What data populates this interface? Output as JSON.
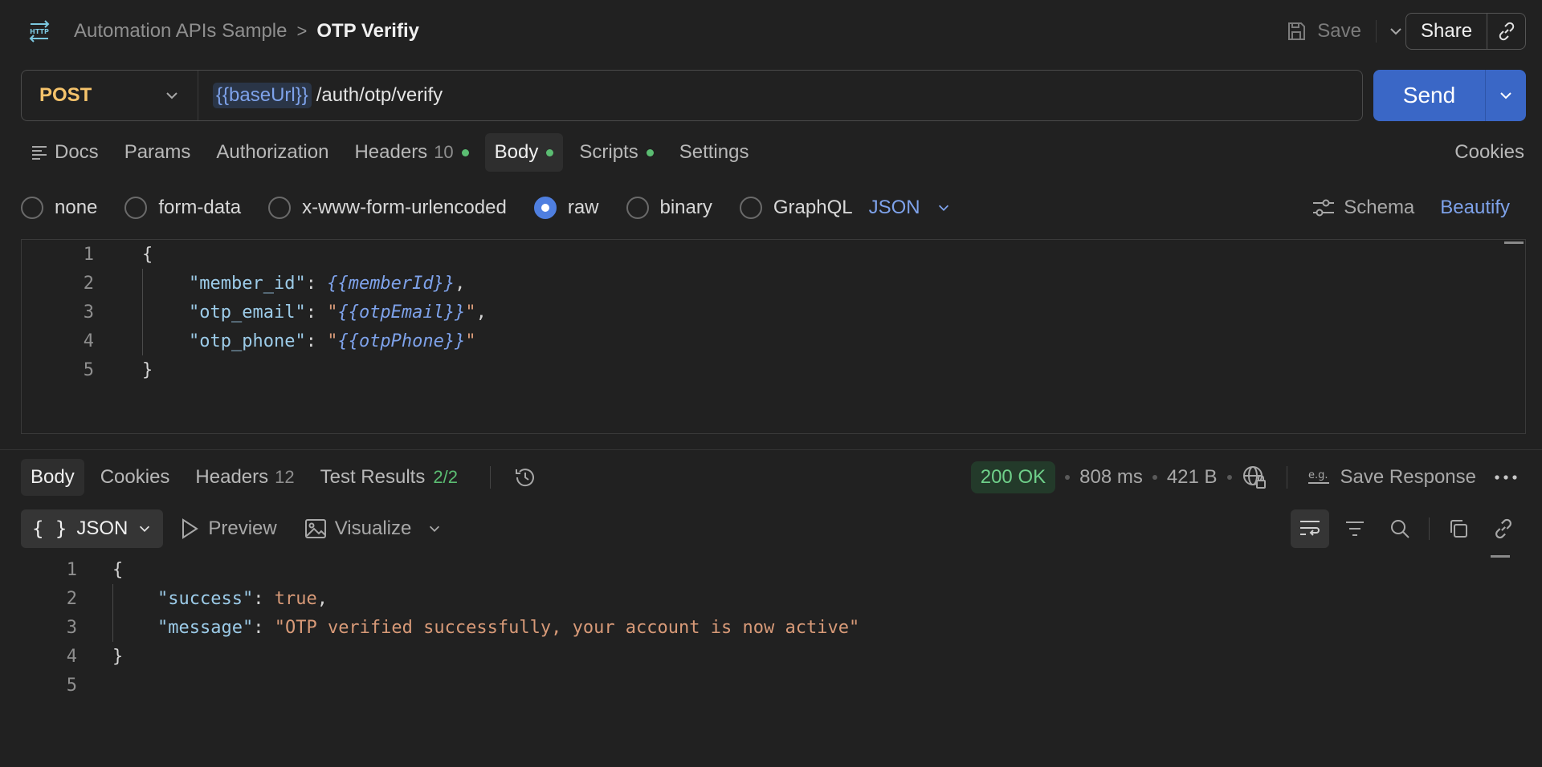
{
  "header": {
    "collection": "Automation APIs Sample",
    "separator": ">",
    "request_name": "OTP Verifiy",
    "save_label": "Save",
    "share_label": "Share"
  },
  "request": {
    "method": "POST",
    "url_variable": "{{baseUrl}}",
    "url_path": "/auth/otp/verify",
    "send_label": "Send"
  },
  "request_tabs": {
    "docs": "Docs",
    "params": "Params",
    "authorization": "Authorization",
    "headers": "Headers",
    "headers_count": "10",
    "body": "Body",
    "scripts": "Scripts",
    "settings": "Settings",
    "cookies": "Cookies"
  },
  "body_types": {
    "none": "none",
    "form_data": "form-data",
    "urlencoded": "x-www-form-urlencoded",
    "raw": "raw",
    "binary": "binary",
    "graphql": "GraphQL",
    "language": "JSON",
    "schema": "Schema",
    "beautify": "Beautify"
  },
  "request_body": {
    "line_numbers": [
      "1",
      "2",
      "3",
      "4",
      "5"
    ],
    "open_brace": "{",
    "close_brace": "}",
    "member_key": "\"member_id\"",
    "member_val": "{{memberId}}",
    "email_key": "\"otp_email\"",
    "email_val": "{{otpEmail}}",
    "phone_key": "\"otp_phone\"",
    "phone_val": "{{otpPhone}}",
    "colon": ": ",
    "comma": ",",
    "quote": "\""
  },
  "response_tabs": {
    "body": "Body",
    "cookies": "Cookies",
    "headers": "Headers",
    "headers_count": "12",
    "test_results": "Test Results",
    "test_count": "2/2"
  },
  "response_meta": {
    "status": "200 OK",
    "time": "808 ms",
    "size": "421 B",
    "save_response": "Save Response"
  },
  "response_toolbar": {
    "format": "JSON",
    "preview": "Preview",
    "visualize": "Visualize"
  },
  "response_body": {
    "line_numbers": [
      "1",
      "2",
      "3",
      "4",
      "5"
    ],
    "open_brace": "{",
    "close_brace": "}",
    "success_key": "\"success\"",
    "success_val": "true",
    "message_key": "\"message\"",
    "message_val": "\"OTP verified successfully, your account is now active\"",
    "colon": ": ",
    "comma": ","
  },
  "colors": {
    "accent": "#3a67c6",
    "method": "#f5c36b",
    "status_ok": "#6fd08a",
    "dot": "#5bbd72"
  }
}
